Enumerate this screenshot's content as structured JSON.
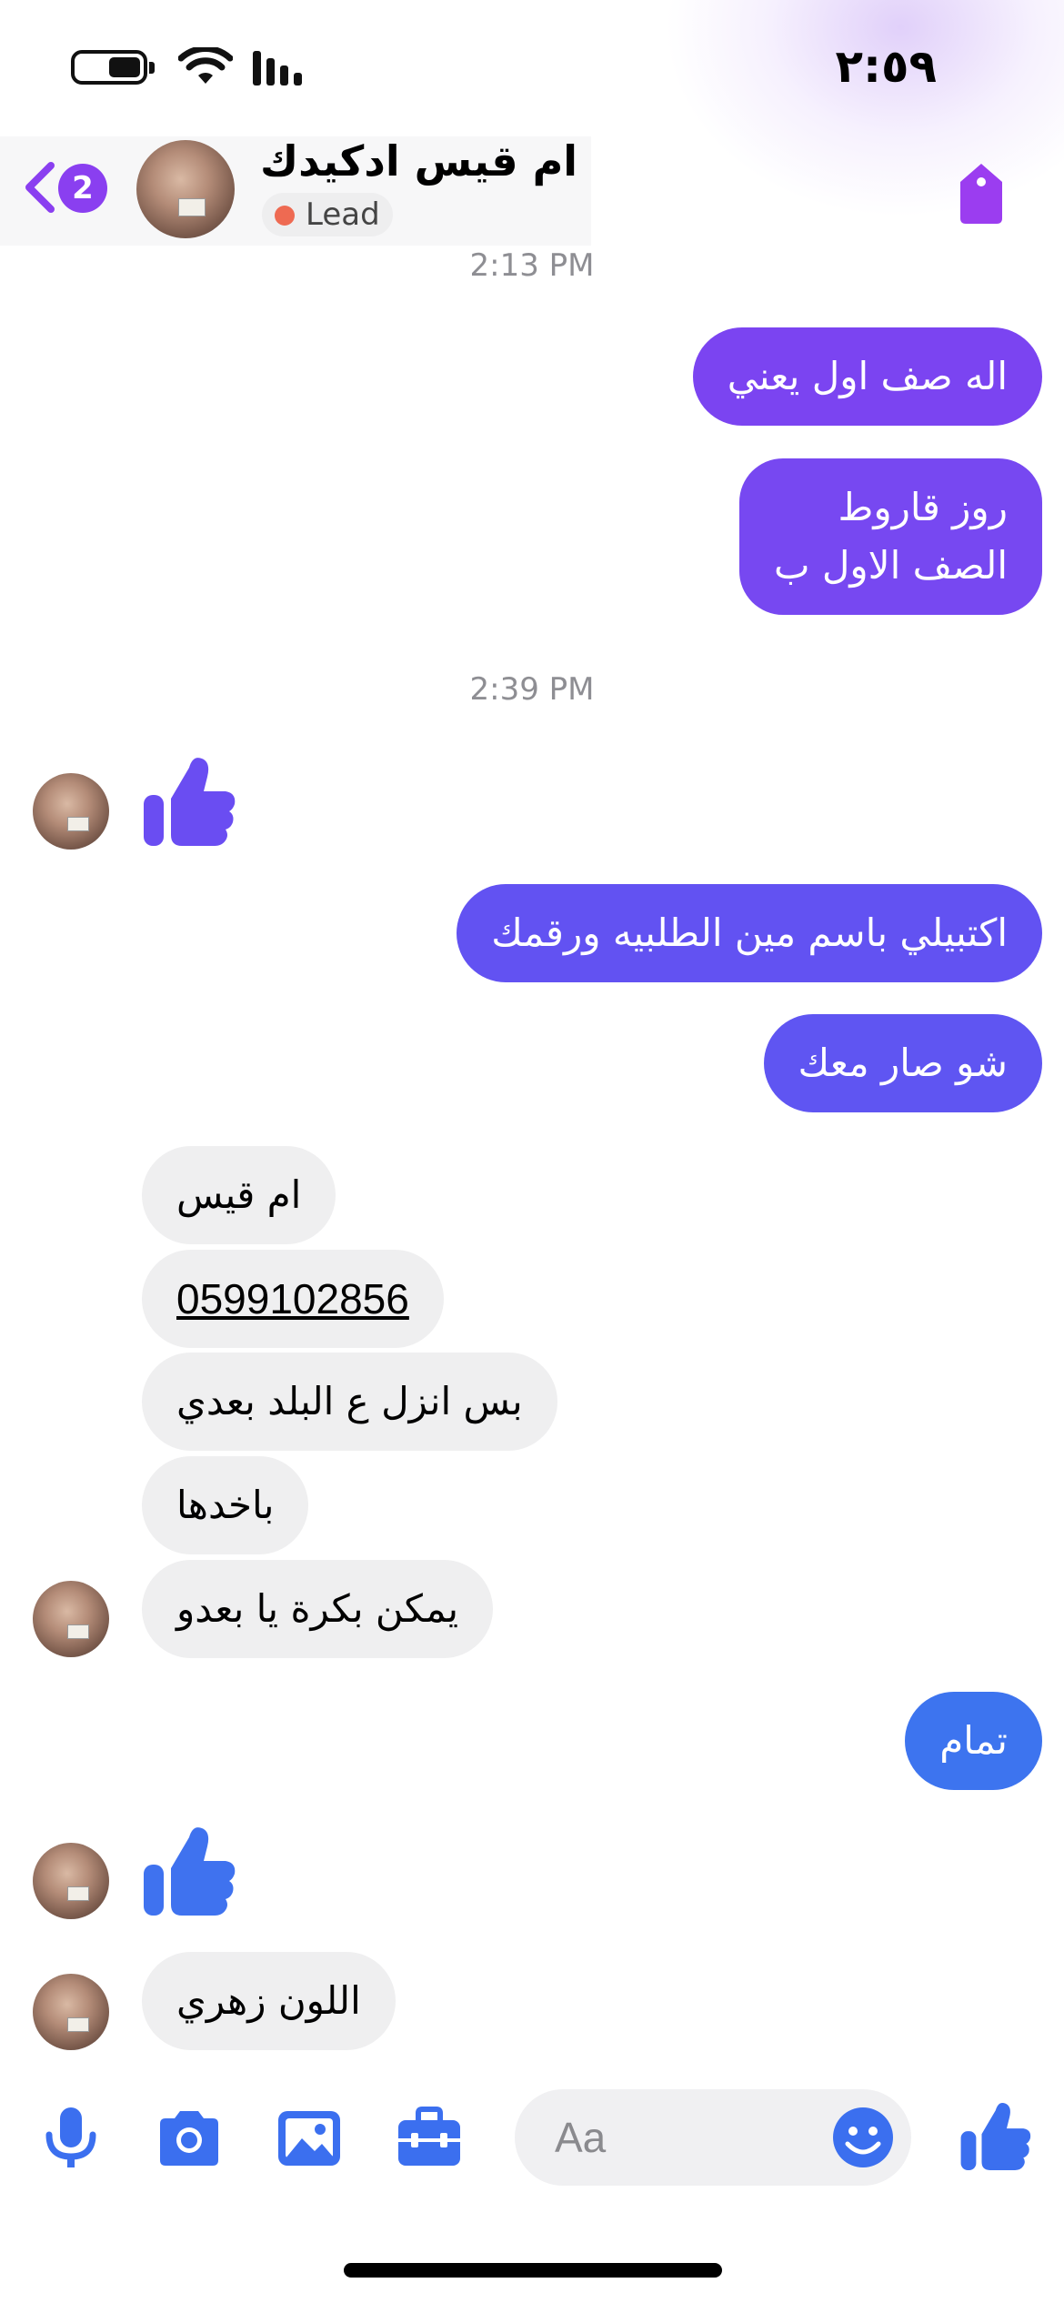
{
  "status_bar": {
    "time": "٢:٥٩",
    "battery_level": 0.45
  },
  "header": {
    "back_badge_count": "2",
    "contact_name": "ام قيس ادكيدك",
    "tag_label": "Lead",
    "tag_dot_color": "#ee6a52",
    "tag_icon": "tag-icon"
  },
  "colors": {
    "accent_purple": "#8a3ff0",
    "bubble_purple": "#7b44f1",
    "bubble_indigo": "#6252f2",
    "bubble_blue": "#3d74ef",
    "incoming_bg": "#efeff0"
  },
  "messages": {
    "ts1": "2:13 PM",
    "m1": "اله صف اول يعني",
    "m2_line1": "روز قاروط",
    "m2_line2": "الصف الاول ب",
    "ts2": "2:39 PM",
    "m3": "اكتبيلي باسم مين الطلبيه ورقمك",
    "m4": "شو صار معك",
    "in1": "ام قيس",
    "in2": "0599102856",
    "in3": "بس انزل ع البلد بعدي",
    "in4": "باخدها",
    "in5": "يمكن بكرة يا بعدو",
    "m5": "تمام",
    "in6": "اللون زهري"
  },
  "composer": {
    "placeholder": "Aa",
    "icons": [
      "mic-icon",
      "camera-icon",
      "gallery-icon",
      "toolbox-icon",
      "emoji-icon",
      "like-icon"
    ]
  }
}
